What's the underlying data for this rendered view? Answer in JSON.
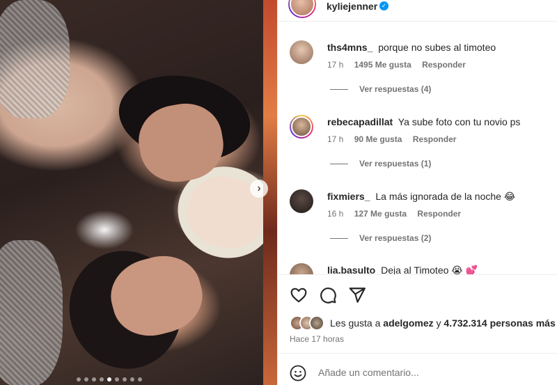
{
  "post": {
    "username": "kyliejenner",
    "verified": true,
    "carousel_dots": 9,
    "carousel_active": 4
  },
  "comments": [
    {
      "user": "ths4mns_",
      "text": "porque no subes al timoteo",
      "time": "17 h",
      "likes": "1495 Me gusta",
      "reply": "Responder",
      "replies": "Ver respuestas (4)"
    },
    {
      "user": "rebecapadillat",
      "text": "Ya sube foto con tu novio ps",
      "time": "17 h",
      "likes": "90 Me gusta",
      "reply": "Responder",
      "replies": "Ver respuestas (1)"
    },
    {
      "user": "fixmiers_",
      "text": "La más ignorada de la noche 😂",
      "time": "16 h",
      "likes": "127 Me gusta",
      "reply": "Responder",
      "replies": "Ver respuestas (2)"
    },
    {
      "user": "lia.basulto",
      "text": "Deja al Timoteo 😭 💕"
    }
  ],
  "likes_summary": {
    "prefix": "Les gusta a",
    "user": "adelgomez",
    "connector": "y",
    "others": "4.732.314 personas más"
  },
  "timestamp": "Hace 17 horas",
  "comment_input": {
    "placeholder": "Añade un comentario..."
  },
  "icons": {
    "like": "heart-icon",
    "comment": "comment-icon",
    "share": "send-icon",
    "emoji": "smiley-icon",
    "next": "chevron-right-icon"
  }
}
